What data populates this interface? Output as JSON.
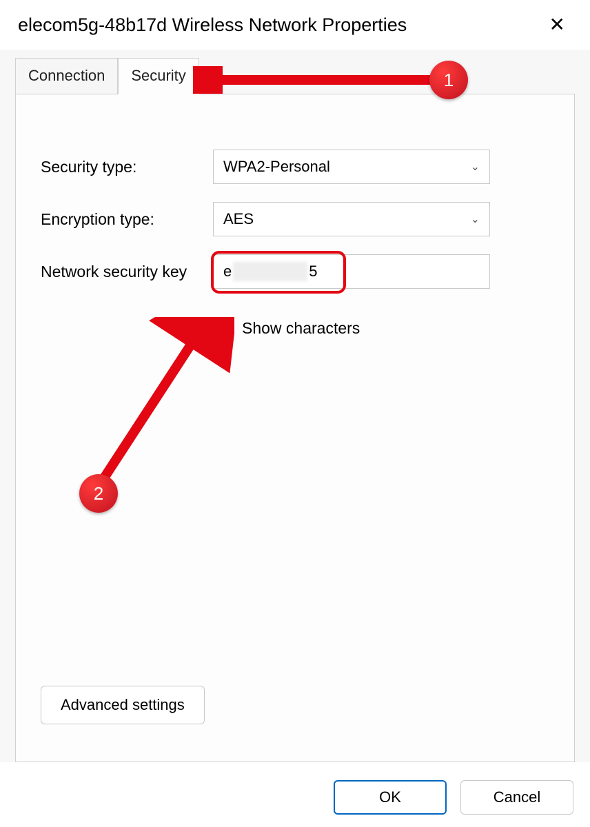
{
  "titlebar": {
    "title": "elecom5g-48b17d Wireless Network Properties"
  },
  "tabs": {
    "connection": "Connection",
    "security": "Security",
    "active": "security"
  },
  "form": {
    "security_type_label": "Security type:",
    "security_type_value": "WPA2-Personal",
    "encryption_type_label": "Encryption type:",
    "encryption_type_value": "AES",
    "network_key_label": "Network security key",
    "network_key_prefix": "e",
    "network_key_suffix": "5",
    "show_characters_label": "Show characters",
    "show_characters_checked": true
  },
  "buttons": {
    "advanced": "Advanced settings",
    "ok": "OK",
    "cancel": "Cancel"
  },
  "annotations": {
    "badge1": "1",
    "badge2": "2"
  }
}
